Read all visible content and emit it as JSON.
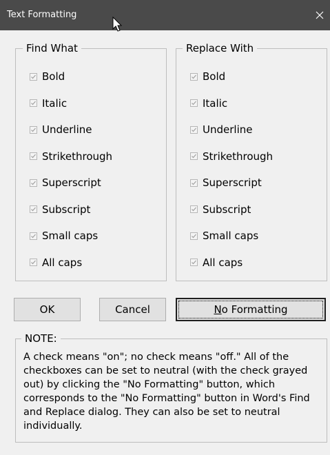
{
  "window": {
    "title": "Text Formatting"
  },
  "find_what": {
    "legend": "Find What",
    "items": [
      {
        "label": "Bold",
        "state": "neutral"
      },
      {
        "label": "Italic",
        "state": "neutral"
      },
      {
        "label": "Underline",
        "state": "neutral"
      },
      {
        "label": "Strikethrough",
        "state": "neutral"
      },
      {
        "label": "Superscript",
        "state": "neutral"
      },
      {
        "label": "Subscript",
        "state": "neutral"
      },
      {
        "label": "Small caps",
        "state": "neutral"
      },
      {
        "label": "All caps",
        "state": "neutral"
      }
    ]
  },
  "replace_with": {
    "legend": "Replace With",
    "items": [
      {
        "label": "Bold",
        "state": "neutral"
      },
      {
        "label": "Italic",
        "state": "neutral"
      },
      {
        "label": "Underline",
        "state": "neutral"
      },
      {
        "label": "Strikethrough",
        "state": "neutral"
      },
      {
        "label": "Superscript",
        "state": "neutral"
      },
      {
        "label": "Subscript",
        "state": "neutral"
      },
      {
        "label": "Small caps",
        "state": "neutral"
      },
      {
        "label": "All caps",
        "state": "neutral"
      }
    ]
  },
  "buttons": {
    "ok_label": "OK",
    "cancel_label": "Cancel",
    "no_formatting_mnemonic": "N",
    "no_formatting_rest": "o Formatting"
  },
  "note": {
    "legend": "NOTE:",
    "text": "A check means \"on\"; no check means \"off.\" All of the checkboxes can be set to neutral (with the check grayed out) by clicking the \"No Formatting\" button, which corresponds to the \"No Formatting\" button in Word's Find and Replace dialog. They can also be set to neutral individually."
  },
  "colors": {
    "titlebar": "#4a4a4a",
    "dialog": "#f0f0f0",
    "neutral_check": "#a0a0a0"
  }
}
